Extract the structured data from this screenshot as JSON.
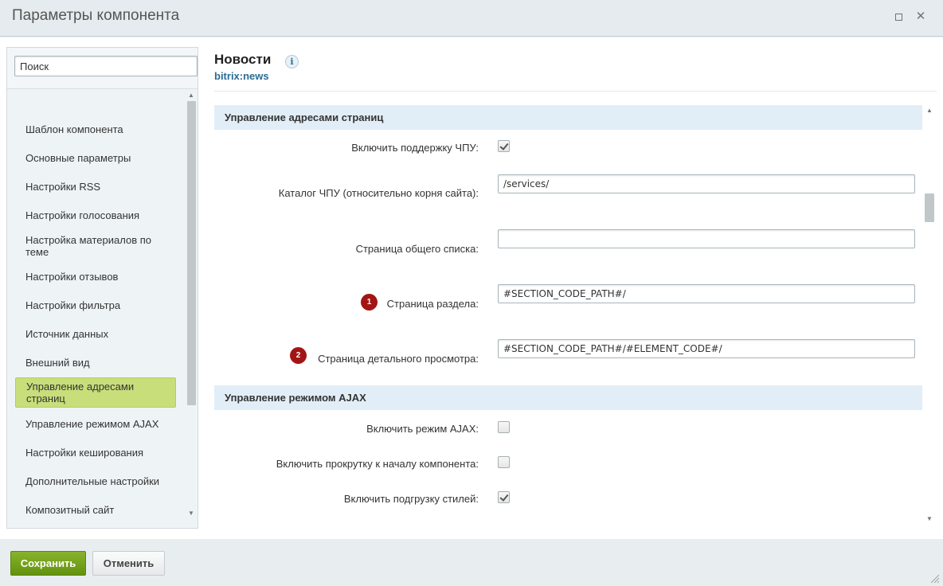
{
  "window": {
    "title": "Параметры компонента",
    "maximize_icon": "maximize-icon",
    "close_icon": "close-icon",
    "close_glyph": "✕"
  },
  "sidebar": {
    "search_placeholder": "Поиск",
    "items": [
      {
        "label": "Шаблон компонента",
        "active": false
      },
      {
        "label": "Основные параметры",
        "active": false
      },
      {
        "label": "Настройки RSS",
        "active": false
      },
      {
        "label": "Настройки голосования",
        "active": false
      },
      {
        "label": "Настройка материалов по теме",
        "active": false
      },
      {
        "label": "Настройки отзывов",
        "active": false
      },
      {
        "label": "Настройки фильтра",
        "active": false
      },
      {
        "label": "Источник данных",
        "active": false
      },
      {
        "label": "Внешний вид",
        "active": false
      },
      {
        "label": "Управление адресами страниц",
        "active": true
      },
      {
        "label": "Управление режимом AJAX",
        "active": false
      },
      {
        "label": "Настройки кеширования",
        "active": false
      },
      {
        "label": "Дополнительные настройки",
        "active": false
      },
      {
        "label": "Композитный сайт",
        "active": false
      }
    ]
  },
  "component": {
    "name": "Новости",
    "code": "bitrix:news",
    "info_glyph": "i"
  },
  "sections": [
    {
      "title": "Управление адресами страниц",
      "fields": [
        {
          "label": "Включить поддержку ЧПУ:",
          "type": "checkbox",
          "checked": true
        },
        {
          "label": "Каталог ЧПУ (относительно корня сайта):",
          "type": "text",
          "value": "/services/"
        },
        {
          "label": "Страница общего списка:",
          "type": "text",
          "value": ""
        },
        {
          "label": "Страница раздела:",
          "type": "text",
          "value": "#SECTION_CODE_PATH#/",
          "badge": "1"
        },
        {
          "label": "Страница детального просмотра:",
          "type": "text",
          "value": "#SECTION_CODE_PATH#/#ELEMENT_CODE#/",
          "badge": "2"
        }
      ]
    },
    {
      "title": "Управление режимом AJAX",
      "fields": [
        {
          "label": "Включить режим AJAX:",
          "type": "checkbox",
          "checked": false
        },
        {
          "label": "Включить прокрутку к началу компонента:",
          "type": "checkbox",
          "checked": false
        },
        {
          "label": "Включить подгрузку стилей:",
          "type": "checkbox",
          "checked": true
        }
      ]
    }
  ],
  "footer": {
    "save_label": "Сохранить",
    "cancel_label": "Отменить"
  },
  "colors": {
    "accent_green": "#74a31b",
    "active_item": "#c8de7a",
    "section_bg": "#e2eef7",
    "badge": "#a31515",
    "link_blue": "#2b6b96"
  }
}
